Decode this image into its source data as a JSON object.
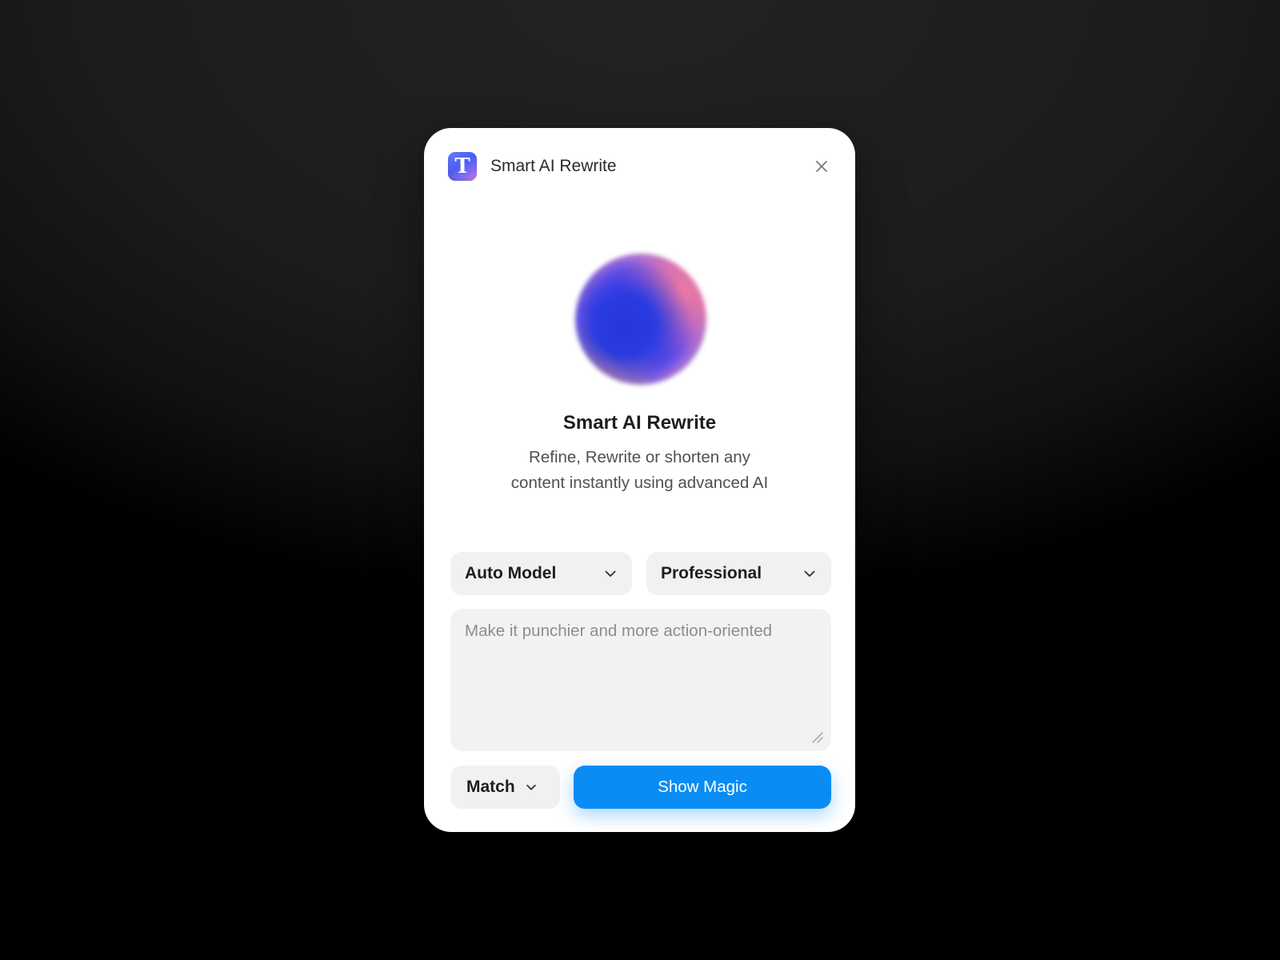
{
  "window": {
    "title": "Smart AI Rewrite",
    "app_icon_letter": "T",
    "close_icon": "close-icon"
  },
  "hero": {
    "title": "Smart AI Rewrite",
    "subtitle_line1": "Refine, Rewrite or shorten any",
    "subtitle_line2": "content instantly using advanced AI"
  },
  "controls": {
    "model_select": "Auto Model",
    "tone_select": "Professional",
    "prompt_placeholder": "Make it punchier and more action-oriented",
    "prompt_value": "",
    "length_select": "Match",
    "submit_label": "Show Magic"
  },
  "colors": {
    "accent": "#0a8cf5",
    "card_background": "#ffffff",
    "field_background": "#f1f1f1"
  }
}
